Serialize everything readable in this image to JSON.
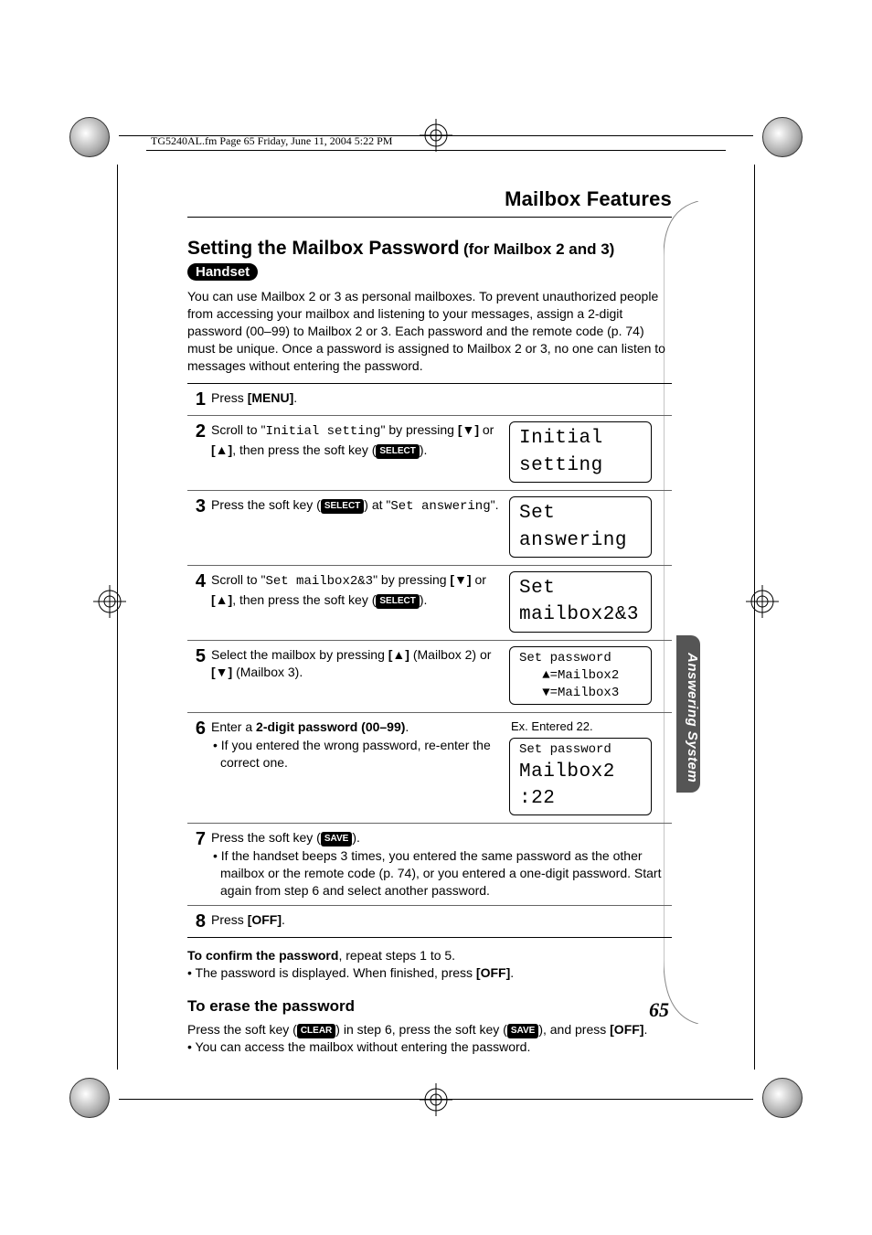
{
  "header_path": "TG5240AL.fm  Page 65  Friday, June 11, 2004  5:22 PM",
  "section_header": "Mailbox Features",
  "title_main": "Setting the Mailbox Password",
  "title_sub": "(for Mailbox 2 and 3)",
  "handset_badge": "Handset",
  "intro": "You can use Mailbox 2 or 3 as personal mailboxes. To prevent unauthorized people from accessing your mailbox and listening to your messages, assign a 2-digit password (00–99) to Mailbox 2 or 3. Each password and the remote code (p. 74) must be unique. Once a password is assigned to Mailbox 2 or 3, no one can listen to messages without entering the password.",
  "steps": {
    "s1": {
      "num": "1",
      "pre": "Press ",
      "b1": "[MENU]",
      "post": "."
    },
    "s2": {
      "num": "2",
      "t1": "Scroll to \"",
      "mono1": "Initial setting",
      "t2": "\" by pressing ",
      "b1": "[▼]",
      "t3": " or ",
      "b2": "[▲]",
      "t4": ", then press the soft key (",
      "key": "SELECT",
      "t5": ").",
      "lcd": "Initial setting"
    },
    "s3": {
      "num": "3",
      "t1": "Press the soft key (",
      "key": "SELECT",
      "t2": ") at \"",
      "mono1": "Set answering",
      "t3": "\".",
      "lcd": "Set answering"
    },
    "s4": {
      "num": "4",
      "t1": "Scroll to \"",
      "mono1": "Set mailbox2&3",
      "t2": "\" by pressing ",
      "b1": "[▼]",
      "t3": " or ",
      "b2": "[▲]",
      "t4": ", then press the soft key (",
      "key": "SELECT",
      "t5": ").",
      "lcd": "Set mailbox2&3"
    },
    "s5": {
      "num": "5",
      "t1": "Select the mailbox by pressing ",
      "b1": "[▲]",
      "t2": " (Mailbox 2) or ",
      "b2": "[▼]",
      "t3": " (Mailbox 3).",
      "lcd_l1": "Set password",
      "lcd_l2": "   ▲=Mailbox2",
      "lcd_l3": "   ▼=Mailbox3"
    },
    "s6": {
      "num": "6",
      "t1": "Enter a ",
      "b1": "2-digit password (00–99)",
      "t2": ".",
      "bullet": "• If you entered the wrong password, re-enter the correct one.",
      "caption": "Ex. Entered 22.",
      "lcd_l1": "Set password",
      "lcd_l2": "Mailbox2 :22"
    },
    "s7": {
      "num": "7",
      "t1": "Press the soft key (",
      "key": "SAVE",
      "t2": ").",
      "bullet": "• If the handset beeps 3 times, you entered the same password as the other mailbox or the remote code (p. 74), or you entered a one-digit password. Start again from step 6 and select another password."
    },
    "s8": {
      "num": "8",
      "pre": "Press ",
      "b1": "[OFF]",
      "post": "."
    }
  },
  "confirm_b": "To confirm the password",
  "confirm_rest": ", repeat steps 1 to 5.",
  "confirm_bullet_pre": "• The password is displayed. When finished, press ",
  "confirm_bullet_b": "[OFF]",
  "confirm_bullet_post": ".",
  "erase_heading": "To erase the password",
  "erase_t1": "Press the soft key (",
  "erase_key1": "CLEAR",
  "erase_t2": ") in step 6, press the soft key (",
  "erase_key2": "SAVE",
  "erase_t3": "), and press ",
  "erase_b": "[OFF]",
  "erase_t4": ".",
  "erase_bullet": "• You can access the mailbox without entering the password.",
  "side_tab": "Answering System",
  "page_number": "65"
}
